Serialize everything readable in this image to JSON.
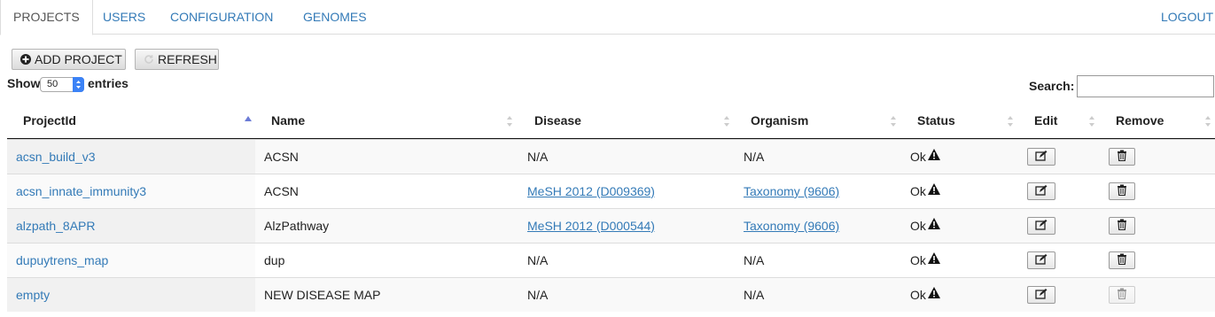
{
  "nav": {
    "tabs": [
      {
        "label": "PROJECTS",
        "active": true
      },
      {
        "label": "USERS"
      },
      {
        "label": "CONFIGURATION"
      },
      {
        "label": "GENOMES"
      }
    ],
    "logout": "LOGOUT"
  },
  "toolbar": {
    "add_label": "ADD PROJECT",
    "refresh_label": "REFRESH"
  },
  "table_controls": {
    "show_label": "Show",
    "page_size": "50",
    "entries_label": "entries",
    "search_label": "Search:",
    "search_value": ""
  },
  "table": {
    "headers": [
      "ProjectId",
      "Name",
      "Disease",
      "Organism",
      "Status",
      "Edit",
      "Remove"
    ],
    "rows": [
      {
        "id": "acsn_build_v3",
        "name": "ACSN",
        "disease": "N/A",
        "organism": "N/A",
        "status": "Ok"
      },
      {
        "id": "acsn_innate_immunity3",
        "name": "ACSN",
        "disease": "MeSH 2012 (D009369)",
        "organism": "Taxonomy (9606)",
        "status": "Ok"
      },
      {
        "id": "alzpath_8APR",
        "name": "AlzPathway",
        "disease": "MeSH 2012 (D000544)",
        "organism": "Taxonomy (9606)",
        "status": "Ok"
      },
      {
        "id": "dupuytrens_map",
        "name": "dup",
        "disease": "N/A",
        "organism": "N/A",
        "status": "Ok"
      },
      {
        "id": "empty",
        "name": "NEW DISEASE MAP",
        "disease": "N/A",
        "organism": "N/A",
        "status": "Ok"
      }
    ]
  },
  "icons": {
    "add": "plus-circle-icon",
    "refresh": "refresh-icon",
    "sort": "sort-icon",
    "warning": "warning-icon",
    "edit": "edit-icon",
    "trash": "trash-icon"
  },
  "colors": {
    "link": "#337ab7",
    "select_accent": "#3b82f6",
    "sort_active": "#6b7bd6"
  }
}
